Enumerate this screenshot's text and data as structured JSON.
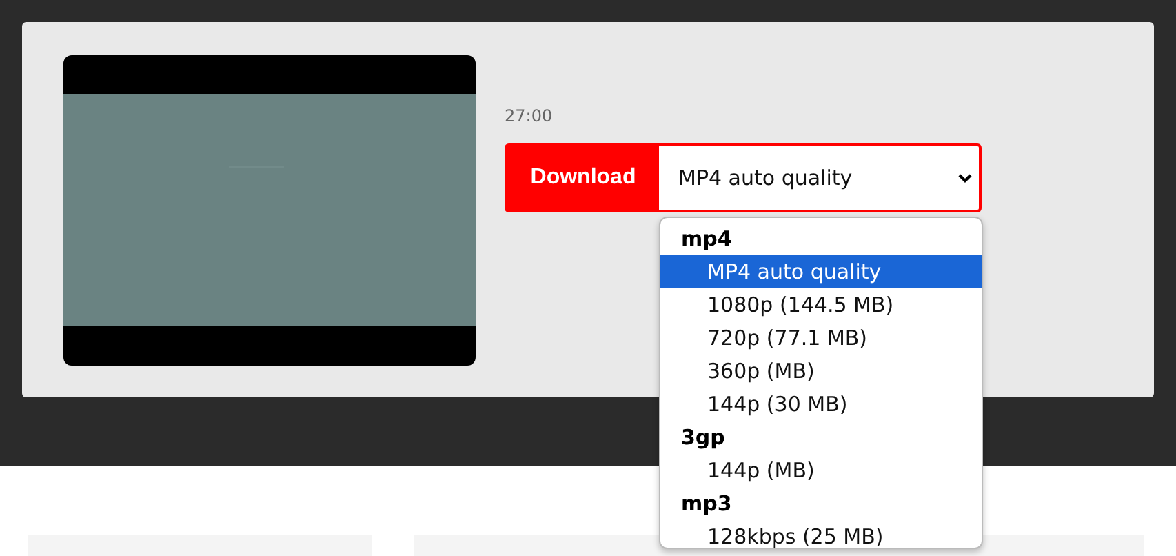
{
  "video": {
    "kind": "picture",
    "duration": "27:00"
  },
  "download_button": "Download",
  "format_select": {
    "value": "MP4 auto quality"
  },
  "dropdown": [
    {
      "group": "mp4",
      "options": [
        {
          "label": "MP4 auto quality",
          "selected": true
        },
        {
          "label": "1080p (144.5 MB)",
          "selected": false
        },
        {
          "label": "720p (77.1 MB)",
          "selected": false
        },
        {
          "label": "360p (MB)",
          "selected": false
        },
        {
          "label": "144p (30 MB)",
          "selected": false
        }
      ]
    },
    {
      "group": "3gp",
      "options": [
        {
          "label": "144p (MB)",
          "selected": false
        }
      ]
    },
    {
      "group": "mp3",
      "options": [
        {
          "label": "128kbps (25 MB)",
          "selected": false
        }
      ]
    }
  ]
}
